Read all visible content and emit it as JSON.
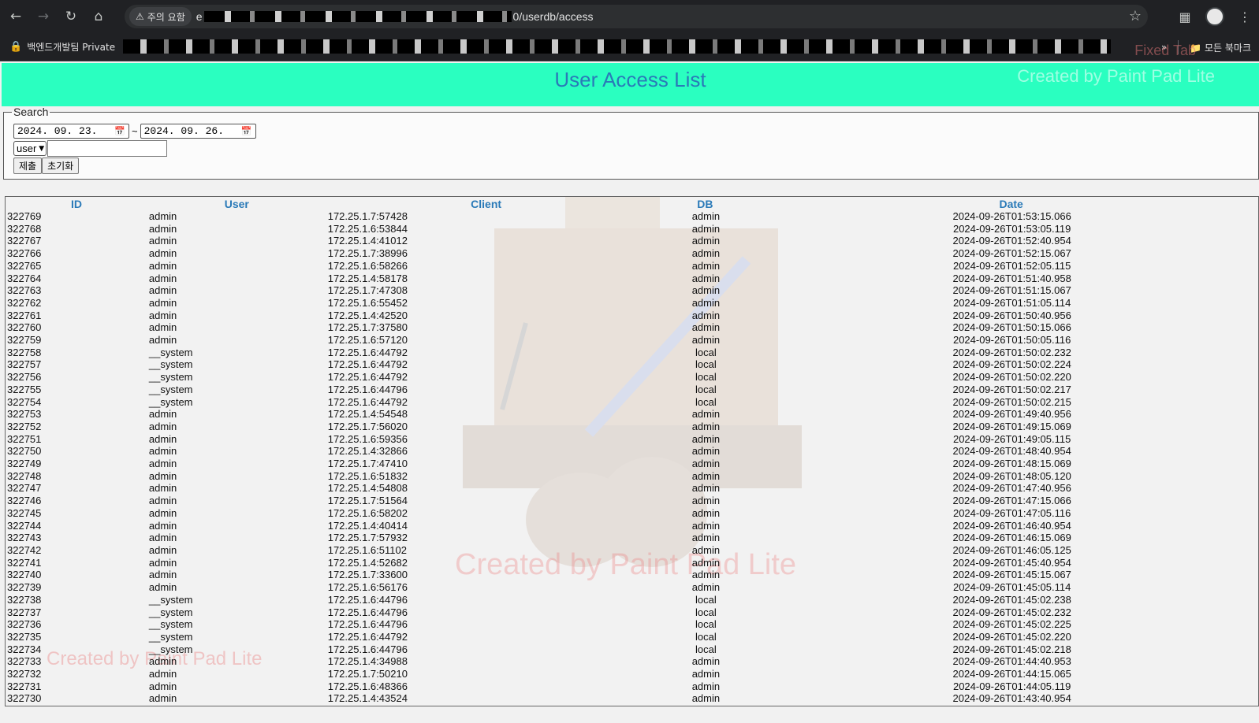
{
  "browser": {
    "security_label": "주의 요함",
    "url_start": "e",
    "url_end": "0/userdb/access",
    "bookmark_label": "백엔드개발팀 Private",
    "all_bookmarks": "모든 북마크"
  },
  "header": {
    "title": "User Access List",
    "watermark": "Created by Paint Pad Lite",
    "watermark_top": "Fixed Tab"
  },
  "search": {
    "legend": "Search",
    "date_from": "2024. 09. 23.",
    "date_to": "2024. 09. 26.",
    "tilde": "~",
    "field_select": "user",
    "field_value": "",
    "submit_label": "제출",
    "reset_label": "초기화"
  },
  "table": {
    "columns": [
      "ID",
      "User",
      "Client",
      "DB",
      "Date"
    ],
    "rows": [
      [
        "322769",
        "admin",
        "172.25.1.7:57428",
        "admin",
        "2024-09-26T01:53:15.066"
      ],
      [
        "322768",
        "admin",
        "172.25.1.6:53844",
        "admin",
        "2024-09-26T01:53:05.119"
      ],
      [
        "322767",
        "admin",
        "172.25.1.4:41012",
        "admin",
        "2024-09-26T01:52:40.954"
      ],
      [
        "322766",
        "admin",
        "172.25.1.7:38996",
        "admin",
        "2024-09-26T01:52:15.067"
      ],
      [
        "322765",
        "admin",
        "172.25.1.6:58266",
        "admin",
        "2024-09-26T01:52:05.115"
      ],
      [
        "322764",
        "admin",
        "172.25.1.4:58178",
        "admin",
        "2024-09-26T01:51:40.958"
      ],
      [
        "322763",
        "admin",
        "172.25.1.7:47308",
        "admin",
        "2024-09-26T01:51:15.067"
      ],
      [
        "322762",
        "admin",
        "172.25.1.6:55452",
        "admin",
        "2024-09-26T01:51:05.114"
      ],
      [
        "322761",
        "admin",
        "172.25.1.4:42520",
        "admin",
        "2024-09-26T01:50:40.956"
      ],
      [
        "322760",
        "admin",
        "172.25.1.7:37580",
        "admin",
        "2024-09-26T01:50:15.066"
      ],
      [
        "322759",
        "admin",
        "172.25.1.6:57120",
        "admin",
        "2024-09-26T01:50:05.116"
      ],
      [
        "322758",
        "__system",
        "172.25.1.6:44792",
        "local",
        "2024-09-26T01:50:02.232"
      ],
      [
        "322757",
        "__system",
        "172.25.1.6:44792",
        "local",
        "2024-09-26T01:50:02.224"
      ],
      [
        "322756",
        "__system",
        "172.25.1.6:44792",
        "local",
        "2024-09-26T01:50:02.220"
      ],
      [
        "322755",
        "__system",
        "172.25.1.6:44796",
        "local",
        "2024-09-26T01:50:02.217"
      ],
      [
        "322754",
        "__system",
        "172.25.1.6:44792",
        "local",
        "2024-09-26T01:50:02.215"
      ],
      [
        "322753",
        "admin",
        "172.25.1.4:54548",
        "admin",
        "2024-09-26T01:49:40.956"
      ],
      [
        "322752",
        "admin",
        "172.25.1.7:56020",
        "admin",
        "2024-09-26T01:49:15.069"
      ],
      [
        "322751",
        "admin",
        "172.25.1.6:59356",
        "admin",
        "2024-09-26T01:49:05.115"
      ],
      [
        "322750",
        "admin",
        "172.25.1.4:32866",
        "admin",
        "2024-09-26T01:48:40.954"
      ],
      [
        "322749",
        "admin",
        "172.25.1.7:47410",
        "admin",
        "2024-09-26T01:48:15.069"
      ],
      [
        "322748",
        "admin",
        "172.25.1.6:51832",
        "admin",
        "2024-09-26T01:48:05.120"
      ],
      [
        "322747",
        "admin",
        "172.25.1.4:54808",
        "admin",
        "2024-09-26T01:47:40.956"
      ],
      [
        "322746",
        "admin",
        "172.25.1.7:51564",
        "admin",
        "2024-09-26T01:47:15.066"
      ],
      [
        "322745",
        "admin",
        "172.25.1.6:58202",
        "admin",
        "2024-09-26T01:47:05.116"
      ],
      [
        "322744",
        "admin",
        "172.25.1.4:40414",
        "admin",
        "2024-09-26T01:46:40.954"
      ],
      [
        "322743",
        "admin",
        "172.25.1.7:57932",
        "admin",
        "2024-09-26T01:46:15.069"
      ],
      [
        "322742",
        "admin",
        "172.25.1.6:51102",
        "admin",
        "2024-09-26T01:46:05.125"
      ],
      [
        "322741",
        "admin",
        "172.25.1.4:52682",
        "admin",
        "2024-09-26T01:45:40.954"
      ],
      [
        "322740",
        "admin",
        "172.25.1.7:33600",
        "admin",
        "2024-09-26T01:45:15.067"
      ],
      [
        "322739",
        "admin",
        "172.25.1.6:56176",
        "admin",
        "2024-09-26T01:45:05.114"
      ],
      [
        "322738",
        "__system",
        "172.25.1.6:44796",
        "local",
        "2024-09-26T01:45:02.238"
      ],
      [
        "322737",
        "__system",
        "172.25.1.6:44796",
        "local",
        "2024-09-26T01:45:02.232"
      ],
      [
        "322736",
        "__system",
        "172.25.1.6:44796",
        "local",
        "2024-09-26T01:45:02.225"
      ],
      [
        "322735",
        "__system",
        "172.25.1.6:44792",
        "local",
        "2024-09-26T01:45:02.220"
      ],
      [
        "322734",
        "__system",
        "172.25.1.6:44796",
        "local",
        "2024-09-26T01:45:02.218"
      ],
      [
        "322733",
        "admin",
        "172.25.1.4:34988",
        "admin",
        "2024-09-26T01:44:40.953"
      ],
      [
        "322732",
        "admin",
        "172.25.1.7:50210",
        "admin",
        "2024-09-26T01:44:15.065"
      ],
      [
        "322731",
        "admin",
        "172.25.1.6:48366",
        "admin",
        "2024-09-26T01:44:05.119"
      ],
      [
        "322730",
        "admin",
        "172.25.1.4:43524",
        "admin",
        "2024-09-26T01:43:40.954"
      ]
    ]
  }
}
